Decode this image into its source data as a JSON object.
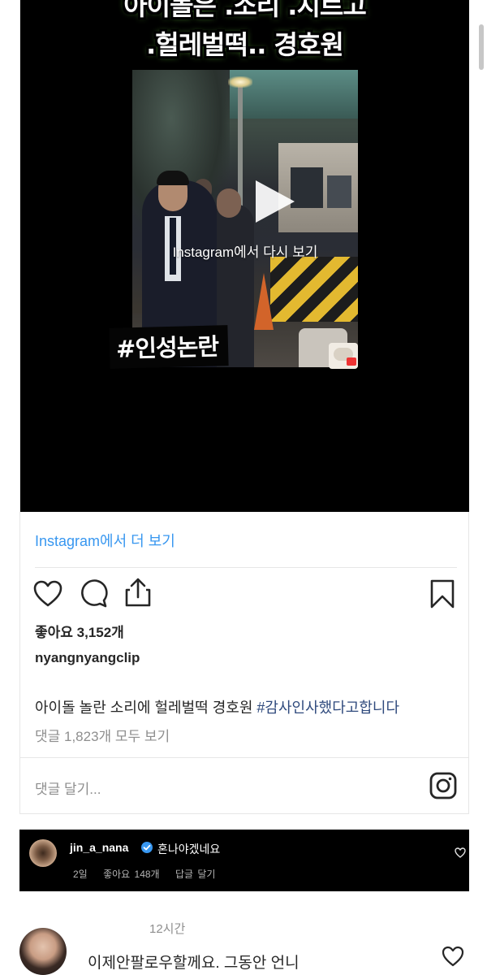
{
  "post": {
    "headline_line1": "아이돌은 .소리 .지르고",
    "headline_line2": ".헐레벌떡.. 경호원",
    "video_overlay": "Instagram에서 다시 보기",
    "hashtag_sticker": "#인성논란",
    "view_more": "Instagram에서 더 보기",
    "likes": "좋아요 3,152개",
    "username": "nyangnyangclip",
    "caption_text": "아이돌 놀란 소리에 헐레벌떡 경호원 ",
    "caption_tag": "#감사인사했다고합니다",
    "view_comments": "댓글 1,823개 모두 보기",
    "add_comment_placeholder": "댓글 달기...",
    "link_color": "#3897f0"
  },
  "icons": {
    "like": "heart-icon",
    "comment": "comment-icon",
    "share": "share-icon",
    "save": "bookmark-icon",
    "instagram": "instagram-icon"
  },
  "comments": [
    {
      "username": "jin_a_nana",
      "verified": true,
      "text": "혼나야겠네요",
      "age": "2일",
      "likes": "좋아요 148개",
      "reply": "답글 달기"
    },
    {
      "time": "12시간",
      "text": "이제안팔로우할께요. 그동안 언니"
    }
  ]
}
